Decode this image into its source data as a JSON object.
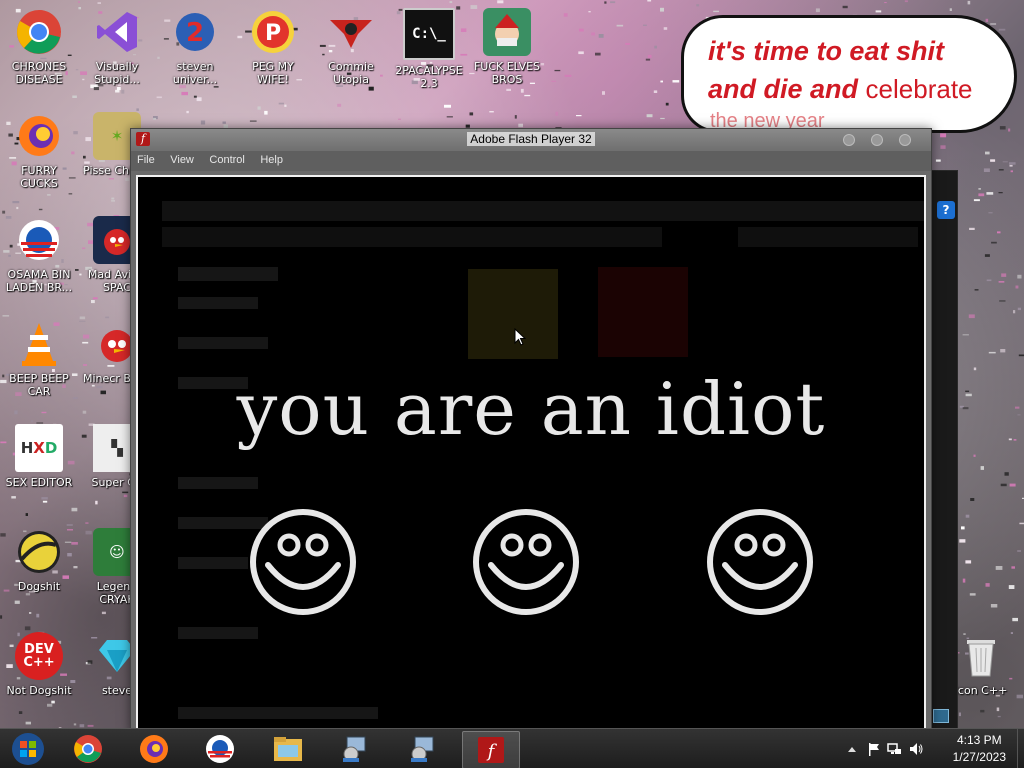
{
  "desktop": {
    "icons": [
      {
        "label": "CHRONES DISEASE",
        "icon": "chrome-icon"
      },
      {
        "label": "Visually Stupid...",
        "icon": "visual-studio-icon"
      },
      {
        "label": "steven univer...",
        "icon": "steven-universe-icon"
      },
      {
        "label": "PEG MY WIFE!",
        "icon": "p-icon"
      },
      {
        "label": "Commie Utopia",
        "icon": "commie-utopia-icon"
      },
      {
        "label": "2PACALYPSE 2.3",
        "icon": "command-prompt-icon"
      },
      {
        "label": "FUCK ELVES BROS",
        "icon": "elf-icon"
      },
      {
        "label": "FURRY CUCKS",
        "icon": "firefox-icon"
      },
      {
        "label": "Pisse Chicke",
        "icon": "chicken-icon"
      },
      {
        "label": "OSAMA BIN LADEN BR...",
        "icon": "obama-logo-icon"
      },
      {
        "label": "Mad Avi IN SPAC",
        "icon": "angry-birds-space-icon"
      },
      {
        "label": "BEEP BEEP CAR",
        "icon": "vlc-icon"
      },
      {
        "label": "Minecr Birds",
        "icon": "angry-birds-icon"
      },
      {
        "label": "SEX EDITOR",
        "icon": "hxd-icon"
      },
      {
        "label": "Super CR",
        "icon": "pixel-game-icon"
      },
      {
        "label": "Dogshit",
        "icon": "dogshit-icon"
      },
      {
        "label": "Legend CRYAK",
        "icon": "legend-icon"
      },
      {
        "label": "Not Dogshit",
        "icon": "dev-cpp-icon"
      },
      {
        "label": "steve",
        "icon": "diamond-icon"
      },
      {
        "label": "Icon C++",
        "icon": "recycle-bin-icon"
      }
    ],
    "bubble": {
      "line1": "it's time to eat shit",
      "line2a": "and die and",
      "line2b": "celebrate",
      "line3": "the new year"
    }
  },
  "flash_window": {
    "title": "Adobe Flash Player 32",
    "menu": [
      "File",
      "View",
      "Control",
      "Help"
    ],
    "message": "you are an idiot",
    "smiley_count": 3
  },
  "taskbar": {
    "items": [
      "start-orb-icon",
      "chrome-icon",
      "firefox-icon",
      "obama-logo-icon",
      "file-explorer-icon",
      "installer-icon",
      "installer-icon",
      "flash-player-icon"
    ],
    "time": "4:13 PM",
    "date": "1/27/2023"
  },
  "colors": {
    "bubble_text": "#d01a24",
    "flash_stage": "#000000",
    "taskbar": "#1d1d1d"
  }
}
